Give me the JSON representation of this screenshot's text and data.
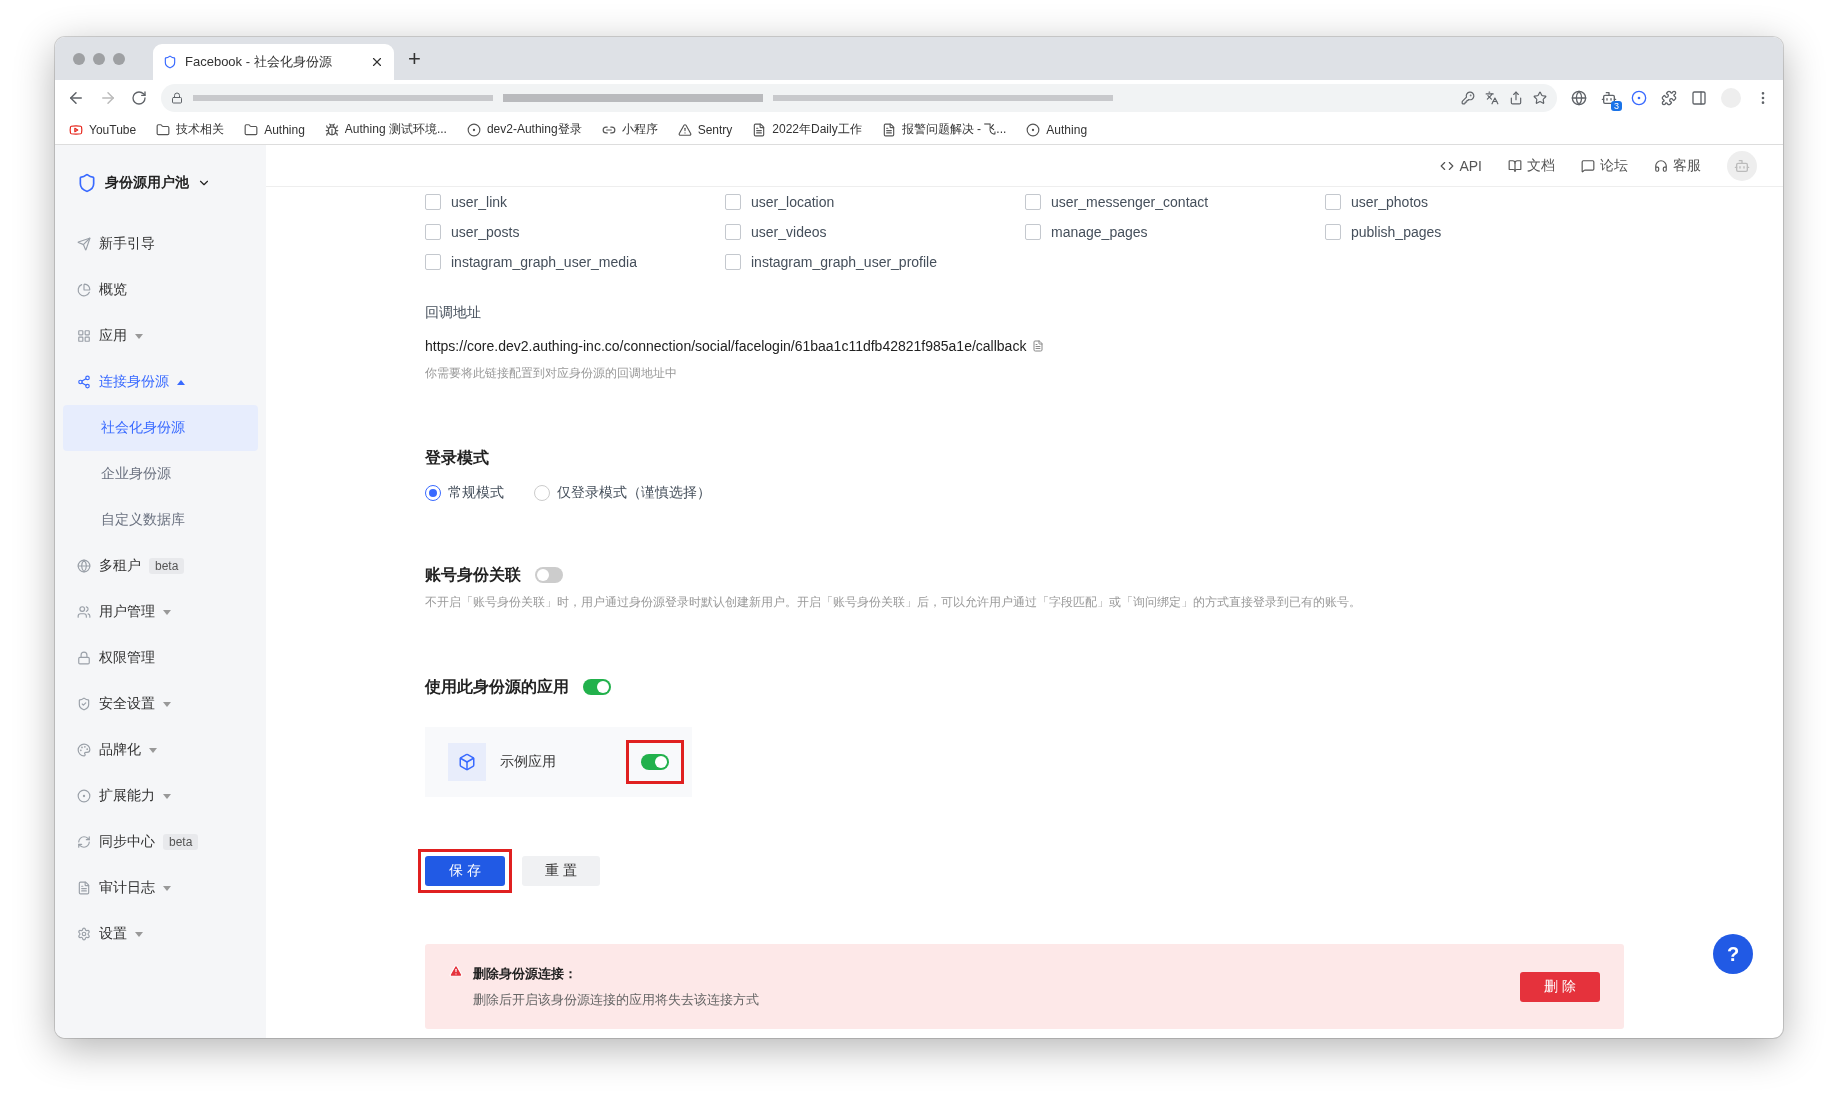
{
  "browser": {
    "tabs": [
      {
        "title": "Facebook - 社会化身份源",
        "selected": true
      }
    ],
    "new_tab": "+",
    "extension_badge": "3",
    "bookmarks": [
      {
        "label": "YouTube"
      },
      {
        "label": "技术相关"
      },
      {
        "label": "Authing"
      },
      {
        "label": "Authing 测试环境..."
      },
      {
        "label": "dev2-Authing登录"
      },
      {
        "label": "小程序"
      },
      {
        "label": "Sentry"
      },
      {
        "label": "2022年Daily工作"
      },
      {
        "label": "报警问题解决 - 飞..."
      },
      {
        "label": "Authing"
      }
    ]
  },
  "sidebar": {
    "title": "身份源用户池",
    "items": [
      {
        "label": "新手引导",
        "expandable": false
      },
      {
        "label": "概览",
        "expandable": false
      },
      {
        "label": "应用",
        "expandable": true,
        "expanded": false
      },
      {
        "label": "连接身份源",
        "expandable": true,
        "expanded": true,
        "selected": true,
        "children": [
          {
            "label": "社会化身份源",
            "selected": true
          },
          {
            "label": "企业身份源",
            "selected": false
          },
          {
            "label": "自定义数据库",
            "selected": false
          }
        ]
      },
      {
        "label": "多租户",
        "expandable": false,
        "badge": "beta"
      },
      {
        "label": "用户管理",
        "expandable": true,
        "expanded": false
      },
      {
        "label": "权限管理",
        "expandable": false
      },
      {
        "label": "安全设置",
        "expandable": true,
        "expanded": false
      },
      {
        "label": "品牌化",
        "expandable": true,
        "expanded": false
      },
      {
        "label": "扩展能力",
        "expandable": true,
        "expanded": false
      },
      {
        "label": "同步中心",
        "expandable": false,
        "badge": "beta"
      },
      {
        "label": "审计日志",
        "expandable": true,
        "expanded": false
      },
      {
        "label": "设置",
        "expandable": true,
        "expanded": false
      }
    ]
  },
  "header_links": [
    {
      "label": "API"
    },
    {
      "label": "文档"
    },
    {
      "label": "论坛"
    },
    {
      "label": "客服"
    }
  ],
  "scopes": [
    {
      "label": "user_link",
      "checked": false
    },
    {
      "label": "user_location",
      "checked": false
    },
    {
      "label": "user_messenger_contact",
      "checked": false
    },
    {
      "label": "user_photos",
      "checked": false
    },
    {
      "label": "user_posts",
      "checked": false
    },
    {
      "label": "user_videos",
      "checked": false
    },
    {
      "label": "manage_pages",
      "checked": false
    },
    {
      "label": "publish_pages",
      "checked": false
    },
    {
      "label": "instagram_graph_user_media",
      "checked": false
    },
    {
      "label": "instagram_graph_user_profile",
      "checked": false
    }
  ],
  "callback": {
    "label": "回调地址",
    "url": "https://core.dev2.authing-inc.co/connection/social/facelogin/61baa1c11dfb42821f985a1e/callback",
    "hint": "你需要将此链接配置到对应身份源的回调地址中"
  },
  "login_mode": {
    "title": "登录模式",
    "options": [
      {
        "label": "常规模式",
        "selected": true
      },
      {
        "label": "仅登录模式（谨慎选择）",
        "selected": false
      }
    ]
  },
  "account_link": {
    "title": "账号身份关联",
    "on": false,
    "description": "不开启「账号身份关联」时，用户通过身份源登录时默认创建新用户。开启「账号身份关联」后，可以允许用户通过「字段匹配」或「询问绑定」的方式直接登录到已有的账号。"
  },
  "apps_section": {
    "title": "使用此身份源的应用",
    "on": true,
    "apps": [
      {
        "name": "示例应用",
        "on": true,
        "highlighted": true
      }
    ]
  },
  "actions": [
    {
      "label": "保 存",
      "kind": "primary",
      "highlighted": true
    },
    {
      "label": "重 置",
      "kind": "default",
      "highlighted": false
    }
  ],
  "danger": {
    "title": "删除身份源连接：",
    "text": "删除后开启该身份源连接的应用将失去该连接方式",
    "button": "删 除"
  },
  "help": "?"
}
